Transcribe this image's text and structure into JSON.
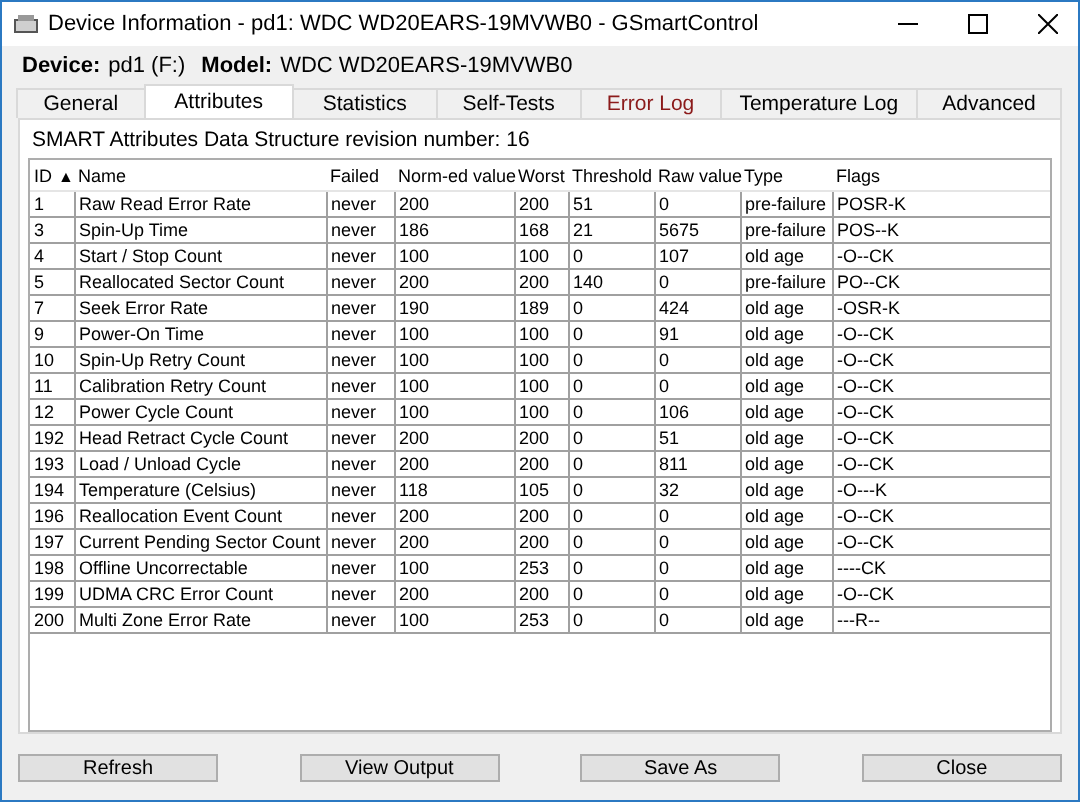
{
  "window": {
    "title": "Device Information - pd1: WDC WD20EARS-19MVWB0 - GSmartControl"
  },
  "device": {
    "device_label": "Device:",
    "device_value": "pd1 (F:)",
    "model_label": "Model:",
    "model_value": "WDC WD20EARS-19MVWB0"
  },
  "tabs": [
    {
      "label": "General",
      "selected": false,
      "alert": false
    },
    {
      "label": "Attributes",
      "selected": true,
      "alert": false
    },
    {
      "label": "Statistics",
      "selected": false,
      "alert": false
    },
    {
      "label": "Self-Tests",
      "selected": false,
      "alert": false
    },
    {
      "label": "Error Log",
      "selected": false,
      "alert": true
    },
    {
      "label": "Temperature Log",
      "selected": false,
      "alert": false
    },
    {
      "label": "Advanced",
      "selected": false,
      "alert": false
    }
  ],
  "revision": "SMART Attributes Data Structure revision number: 16",
  "table": {
    "columns": [
      {
        "label": "ID",
        "sort_glyph": "▲"
      },
      {
        "label": "Name"
      },
      {
        "label": "Failed"
      },
      {
        "label": "Norm-ed value"
      },
      {
        "label": "Worst"
      },
      {
        "label": "Threshold"
      },
      {
        "label": "Raw value"
      },
      {
        "label": "Type"
      },
      {
        "label": "Flags"
      }
    ],
    "rows": [
      [
        "1",
        "Raw Read Error Rate",
        "never",
        "200",
        "200",
        "51",
        "0",
        "pre-failure",
        "POSR-K"
      ],
      [
        "3",
        "Spin-Up Time",
        "never",
        "186",
        "168",
        "21",
        "5675",
        "pre-failure",
        "POS--K"
      ],
      [
        "4",
        "Start / Stop Count",
        "never",
        "100",
        "100",
        "0",
        "107",
        "old age",
        "-O--CK"
      ],
      [
        "5",
        "Reallocated Sector Count",
        "never",
        "200",
        "200",
        "140",
        "0",
        "pre-failure",
        "PO--CK"
      ],
      [
        "7",
        "Seek Error Rate",
        "never",
        "190",
        "189",
        "0",
        "424",
        "old age",
        "-OSR-K"
      ],
      [
        "9",
        "Power-On Time",
        "never",
        "100",
        "100",
        "0",
        "91",
        "old age",
        "-O--CK"
      ],
      [
        "10",
        "Spin-Up Retry Count",
        "never",
        "100",
        "100",
        "0",
        "0",
        "old age",
        "-O--CK"
      ],
      [
        "11",
        "Calibration Retry Count",
        "never",
        "100",
        "100",
        "0",
        "0",
        "old age",
        "-O--CK"
      ],
      [
        "12",
        "Power Cycle Count",
        "never",
        "100",
        "100",
        "0",
        "106",
        "old age",
        "-O--CK"
      ],
      [
        "192",
        "Head Retract Cycle Count",
        "never",
        "200",
        "200",
        "0",
        "51",
        "old age",
        "-O--CK"
      ],
      [
        "193",
        "Load / Unload Cycle",
        "never",
        "200",
        "200",
        "0",
        "811",
        "old age",
        "-O--CK"
      ],
      [
        "194",
        "Temperature (Celsius)",
        "never",
        "118",
        "105",
        "0",
        "32",
        "old age",
        "-O---K"
      ],
      [
        "196",
        "Reallocation Event Count",
        "never",
        "200",
        "200",
        "0",
        "0",
        "old age",
        "-O--CK"
      ],
      [
        "197",
        "Current Pending Sector Count",
        "never",
        "200",
        "200",
        "0",
        "0",
        "old age",
        "-O--CK"
      ],
      [
        "198",
        "Offline Uncorrectable",
        "never",
        "100",
        "253",
        "0",
        "0",
        "old age",
        "----CK"
      ],
      [
        "199",
        "UDMA CRC Error Count",
        "never",
        "200",
        "200",
        "0",
        "0",
        "old age",
        "-O--CK"
      ],
      [
        "200",
        "Multi Zone Error Rate",
        "never",
        "100",
        "253",
        "0",
        "0",
        "old age",
        "---R--"
      ]
    ]
  },
  "buttons": [
    "Refresh",
    "View Output",
    "Save As",
    "Close"
  ]
}
